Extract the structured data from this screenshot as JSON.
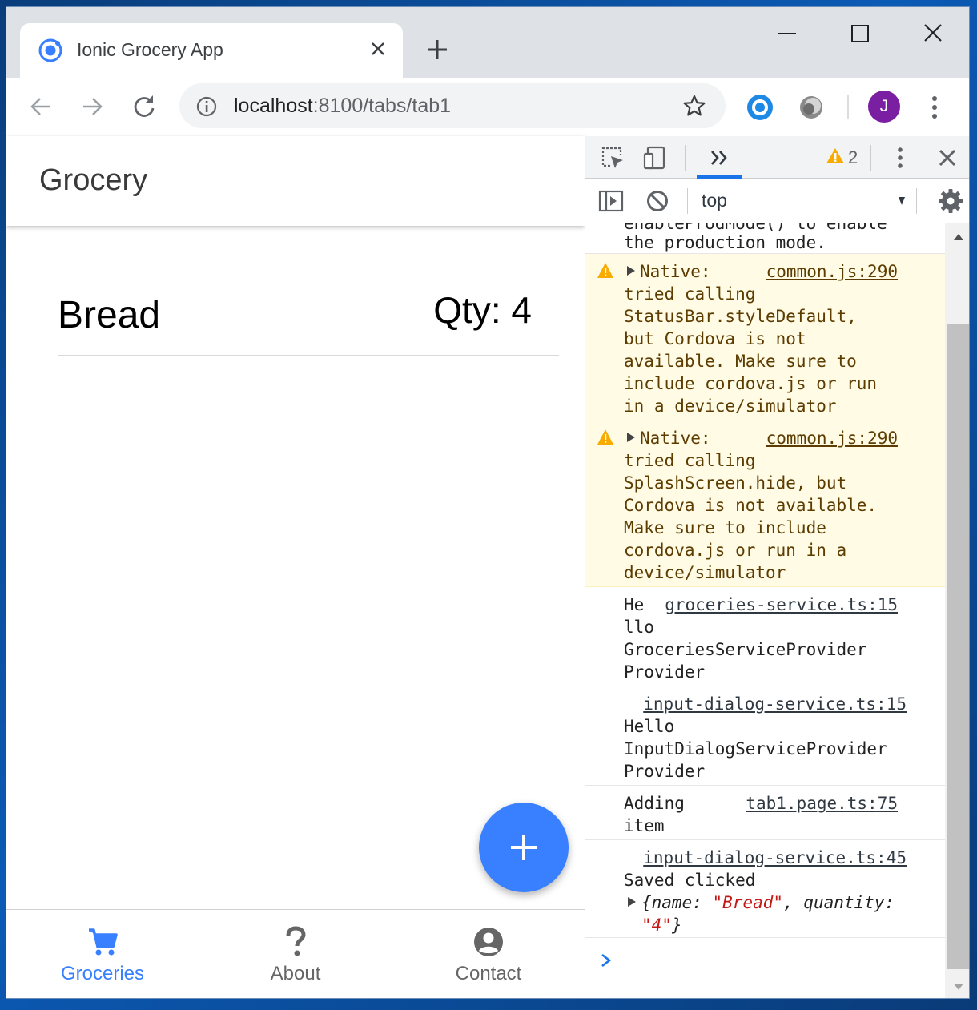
{
  "browser": {
    "tab_title": "Ionic Grocery App",
    "url_host": "localhost",
    "url_rest": ":8100/tabs/tab1",
    "profile_initial": "J",
    "window_controls": [
      "minimize-icon",
      "maximize-icon",
      "close-icon"
    ]
  },
  "app": {
    "header_title": "Grocery",
    "items": [
      {
        "name": "Bread",
        "qty_label": "Qty: 4"
      }
    ],
    "fab_icon": "plus-icon",
    "tabs": [
      {
        "label": "Groceries",
        "icon": "cart-icon",
        "active": true
      },
      {
        "label": "About",
        "icon": "question-icon",
        "active": false
      },
      {
        "label": "Contact",
        "icon": "person-circle-icon",
        "active": false
      }
    ],
    "accent_color": "#3880ff"
  },
  "devtools": {
    "warning_count": "2",
    "context": "top",
    "console": {
      "partial_top": "enableProdMode() to enable",
      "partial_line": "the production mode.",
      "messages": [
        {
          "level": "warning",
          "prefix": "Native:",
          "source": "common.js:290",
          "lines": [
            "tried calling",
            "StatusBar.styleDefault,",
            "but Cordova is not",
            "available. Make sure to",
            "include cordova.js or run",
            "in a device/simulator"
          ]
        },
        {
          "level": "warning",
          "prefix": "Native:",
          "source": "common.js:290",
          "lines": [
            "tried calling",
            "SplashScreen.hide, but",
            "Cordova is not available.",
            "Make sure to include",
            "cordova.js or run in a",
            "device/simulator"
          ]
        },
        {
          "level": "log",
          "prefix": "He",
          "source": "groceries-service.ts:15",
          "lines": [
            "llo",
            "GroceriesServiceProvider",
            "Provider"
          ]
        },
        {
          "level": "log",
          "prefix": "",
          "source": "input-dialog-service.ts:15",
          "lines": [
            "Hello",
            "InputDialogServiceProvider",
            "Provider"
          ]
        },
        {
          "level": "log",
          "prefix": "Adding",
          "source": "tab1.page.ts:75",
          "lines": [
            "item"
          ]
        },
        {
          "level": "log",
          "prefix": "",
          "source": "input-dialog-service.ts:45",
          "lines": [
            "Saved clicked"
          ],
          "object": {
            "open": "{name: ",
            "name_value": "\"Bread\"",
            "mid": ", quantity:",
            "qty_value": "\"4\"",
            "close": "}"
          }
        }
      ]
    },
    "warning_color": "#f9ab00",
    "link_color": "#1a73e8"
  }
}
